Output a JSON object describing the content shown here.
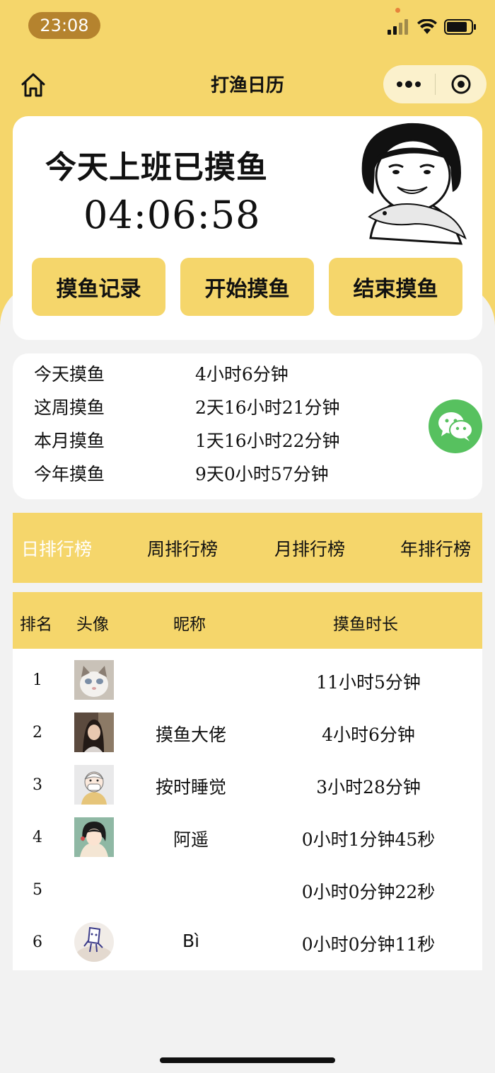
{
  "status": {
    "time": "23:08"
  },
  "nav": {
    "title": "打渔日历"
  },
  "main": {
    "headline": "今天上班已摸鱼",
    "timer": "04:06:58",
    "buttons": [
      "摸鱼记录",
      "开始摸鱼",
      "结束摸鱼"
    ]
  },
  "stats": [
    {
      "label": "今天摸鱼",
      "value": "4小时6分钟"
    },
    {
      "label": "这周摸鱼",
      "value": "2天16小时21分钟"
    },
    {
      "label": "本月摸鱼",
      "value": "1天16小时22分钟"
    },
    {
      "label": "今年摸鱼",
      "value": "9天0小时57分钟"
    }
  ],
  "tabs": [
    "日排行榜",
    "周排行榜",
    "月排行榜",
    "年排行榜"
  ],
  "active_tab": "日排行榜",
  "table": {
    "headers": [
      "排名",
      "头像",
      "昵称",
      "摸鱼时长"
    ],
    "rows": [
      {
        "rank": "1",
        "nickname": "",
        "duration": "11小时5分钟"
      },
      {
        "rank": "2",
        "nickname": "摸鱼大佬",
        "duration": "4小时6分钟"
      },
      {
        "rank": "3",
        "nickname": "按时睡觉",
        "duration": "3小时28分钟"
      },
      {
        "rank": "4",
        "nickname": "阿遥",
        "duration": "0小时1分钟45秒"
      },
      {
        "rank": "5",
        "nickname": "",
        "duration": "0小时0分钟22秒"
      },
      {
        "rank": "6",
        "nickname": "Bì",
        "duration": "0小时0分钟11秒"
      }
    ]
  },
  "colors": {
    "accent": "#f5d66b",
    "time_pill": "#b5832e",
    "wechat": "#57c15f"
  },
  "icons": [
    "home-icon",
    "more-dots-icon",
    "close-target-icon",
    "wechat-icon",
    "signal-icon",
    "wifi-icon",
    "battery-icon"
  ]
}
